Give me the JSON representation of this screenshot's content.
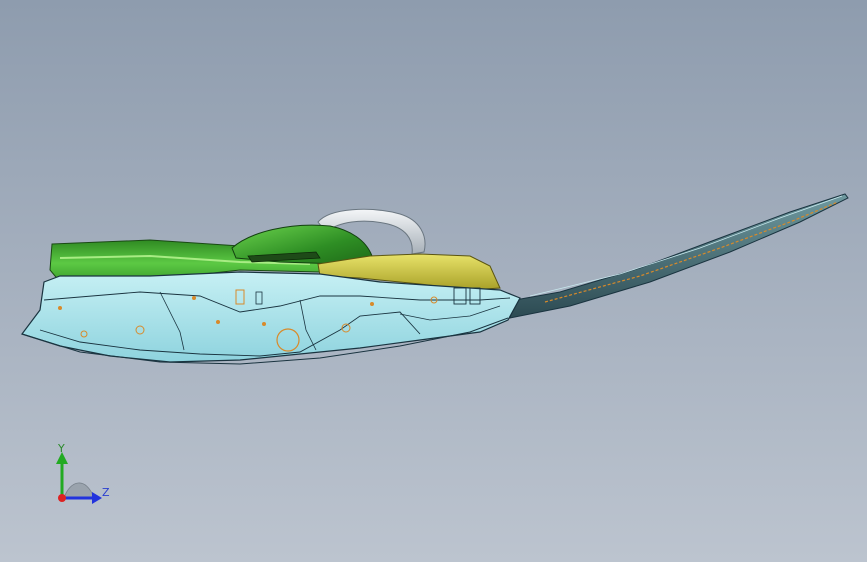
{
  "viewport": {
    "background_top": "#8e9cae",
    "background_bottom": "#bcc4cf",
    "model": {
      "name": "trim-part-assembly",
      "colors": {
        "outer_panel": "#aee4ec",
        "outer_panel_edge": "#1a3440",
        "top_cover": "#4fbf3a",
        "top_cover_highlight": "#8fe06a",
        "dome": "#3daa2e",
        "handle": "#d8dde2",
        "yellow_insert": "#d7d24a",
        "tail_blade": "#3f6a72",
        "hole_marker": "#d88a2a"
      }
    }
  },
  "triad": {
    "y_label": "Y",
    "z_label": "Z",
    "colors": {
      "y_axis": "#22aa22",
      "z_axis": "#2233dd",
      "origin": "#dd2222",
      "cone": "#9aa3ad"
    }
  }
}
